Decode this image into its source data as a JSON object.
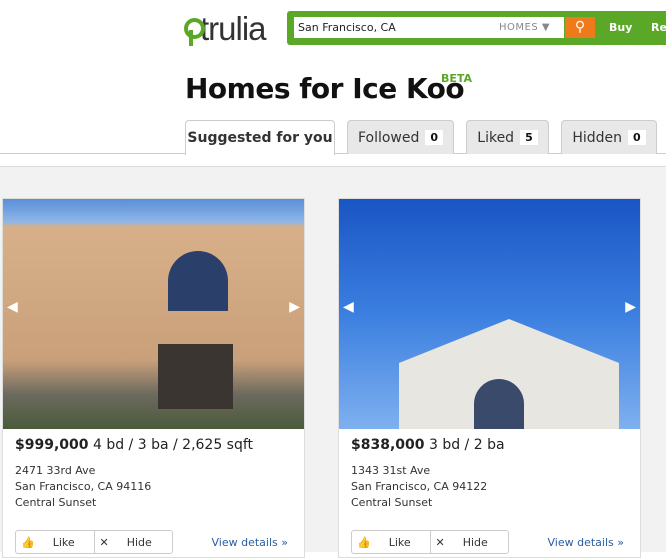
{
  "header": {
    "logo": "trulia",
    "search_value": "San Francisco, CA",
    "search_type": "HOMES ▼",
    "nav": [
      "Buy",
      "Re"
    ]
  },
  "page": {
    "title": "Homes for Ice Koo",
    "badge": "BETA"
  },
  "tabs": [
    {
      "label": "Suggested for you"
    },
    {
      "label": "Followed",
      "count": "0"
    },
    {
      "label": "Liked",
      "count": "5"
    },
    {
      "label": "Hidden",
      "count": "0"
    }
  ],
  "listings": [
    {
      "price": "$999,000",
      "details": "4 bd / 3 ba / 2,625 sqft",
      "street": "2471 33rd Ave",
      "city": "San Francisco, CA 94116",
      "neighborhood": "Central Sunset",
      "like": "Like",
      "hide": "Hide",
      "view": "View details »"
    },
    {
      "price": "$838,000",
      "details": "3 bd / 2 ba",
      "street": "1343 31st Ave",
      "city": "San Francisco, CA 94122",
      "neighborhood": "Central Sunset",
      "like": "Like",
      "hide": "Hide",
      "view": "View details »"
    }
  ],
  "colors": {
    "brand": "#5ba829",
    "search_button": "#ee7a1b",
    "link": "#2a5d9f"
  }
}
